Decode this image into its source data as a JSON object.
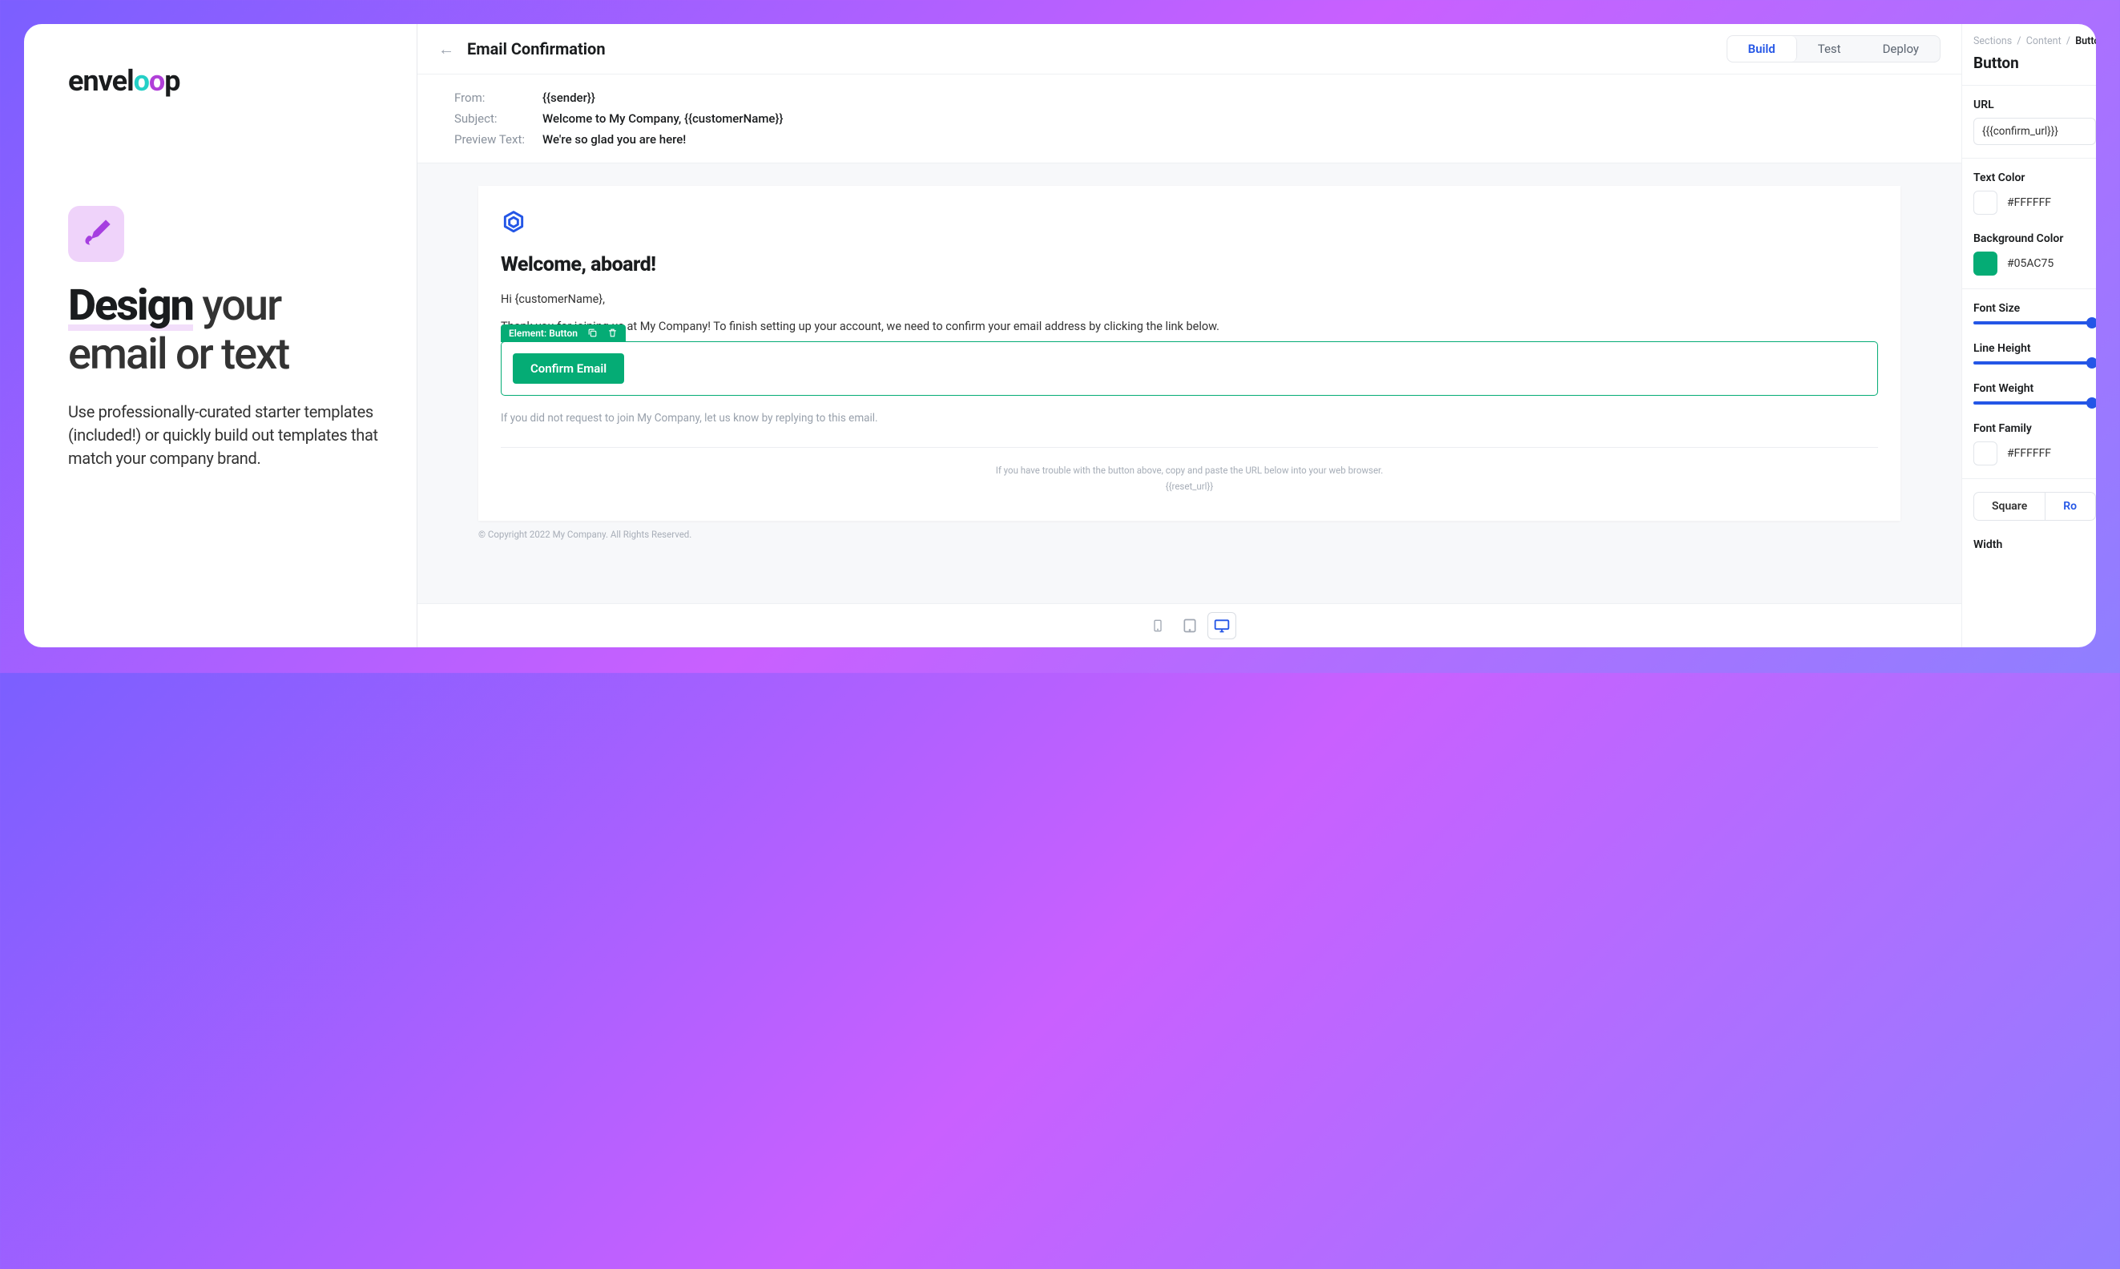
{
  "brand": "enveloop",
  "hero": {
    "bold": "Design",
    "rest1": " your",
    "rest2": "email or text",
    "sub": "Use professionally-curated starter templates (included!) or quickly build out templates that match your company brand."
  },
  "topbar": {
    "title": "Email Confirmation",
    "tabs": {
      "build": "Build",
      "test": "Test",
      "deploy": "Deploy"
    }
  },
  "meta": {
    "from_label": "From:",
    "from_value": "{{sender}}",
    "subject_label": "Subject:",
    "subject_value": "Welcome to My Company, {{customerName}}",
    "preview_label": "Preview Text:",
    "preview_value": "We're so glad you are here!"
  },
  "email": {
    "heading": "Welcome, aboard!",
    "greeting": "Hi {customerName},",
    "body": "Thank you for joining us at My Company! To finish setting up your account, we need to confirm your email address by clicking the link below.",
    "element_label": "Element: Button",
    "cta": "Confirm Email",
    "disclaimer": "If you did not request to join My Company, let us know by replying to this email.",
    "footer1": "If you have trouble with the button above, copy and paste the URL below into your web browser.",
    "footer2": "{{reset_url}}",
    "copyright": "© Copyright 2022 My Company. All Rights Reserved."
  },
  "panel": {
    "crumbs": {
      "a": "Sections",
      "b": "Content",
      "c": "Button"
    },
    "title": "Button",
    "url_label": "URL",
    "url_value": "{{{confirm_url}}}",
    "text_color_label": "Text Color",
    "text_color_value": "#FFFFFF",
    "bg_color_label": "Background Color",
    "bg_color_value": "#05AC75",
    "font_size_label": "Font Size",
    "line_height_label": "Line Height",
    "font_weight_label": "Font Weight",
    "font_family_label": "Font Family",
    "font_family_value": "#FFFFFF",
    "shape_square": "Square",
    "shape_round": "Ro",
    "width_label": "Width"
  },
  "colors": {
    "accent": "#2456E6",
    "green": "#05AC75"
  }
}
